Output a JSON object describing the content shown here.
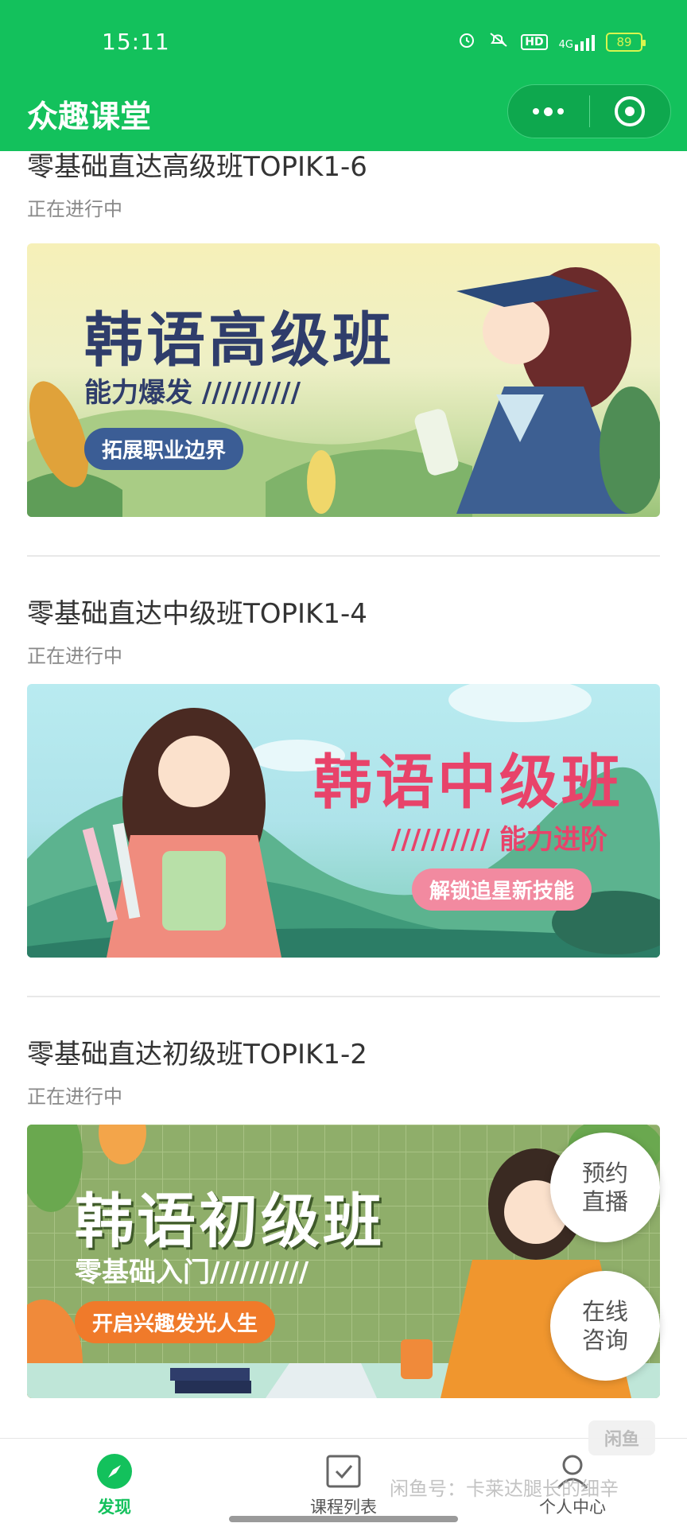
{
  "status_bar": {
    "time": "15:11",
    "battery": "89",
    "hd_label": "HD",
    "network": "4G"
  },
  "header": {
    "title": "众趣课堂"
  },
  "courses": [
    {
      "title": "零基础直达高级班TOPIK1-6",
      "status": "正在进行中",
      "banner": {
        "headline": "韩语高级班",
        "sub": "能力爆发 //////////",
        "pill": "拓展职业边界"
      }
    },
    {
      "title": "零基础直达中级班TOPIK1-4",
      "status": "正在进行中",
      "banner": {
        "headline": "韩语中级班",
        "sub": "////////// 能力进阶",
        "pill": "解锁追星新技能"
      }
    },
    {
      "title": "零基础直达初级班TOPIK1-2",
      "status": "正在进行中",
      "banner": {
        "headline": "韩语初级班",
        "sub": "零基础入门//////////",
        "pill": "开启兴趣发光人生"
      }
    }
  ],
  "float_buttons": {
    "live": [
      "预约",
      "直播"
    ],
    "consult": [
      "在线",
      "咨询"
    ]
  },
  "tabbar": {
    "discover": "发现",
    "course_list": "课程列表",
    "profile": "个人中心"
  },
  "watermark": {
    "text": "闲鱼号：卡莱达腿长的细辛",
    "logo": "闲鱼"
  },
  "colors": {
    "brand": "#13c15c",
    "banner1_headline": "#2f3d6b",
    "banner2_headline": "#e8436a",
    "banner3_headline": "#ffffff"
  }
}
